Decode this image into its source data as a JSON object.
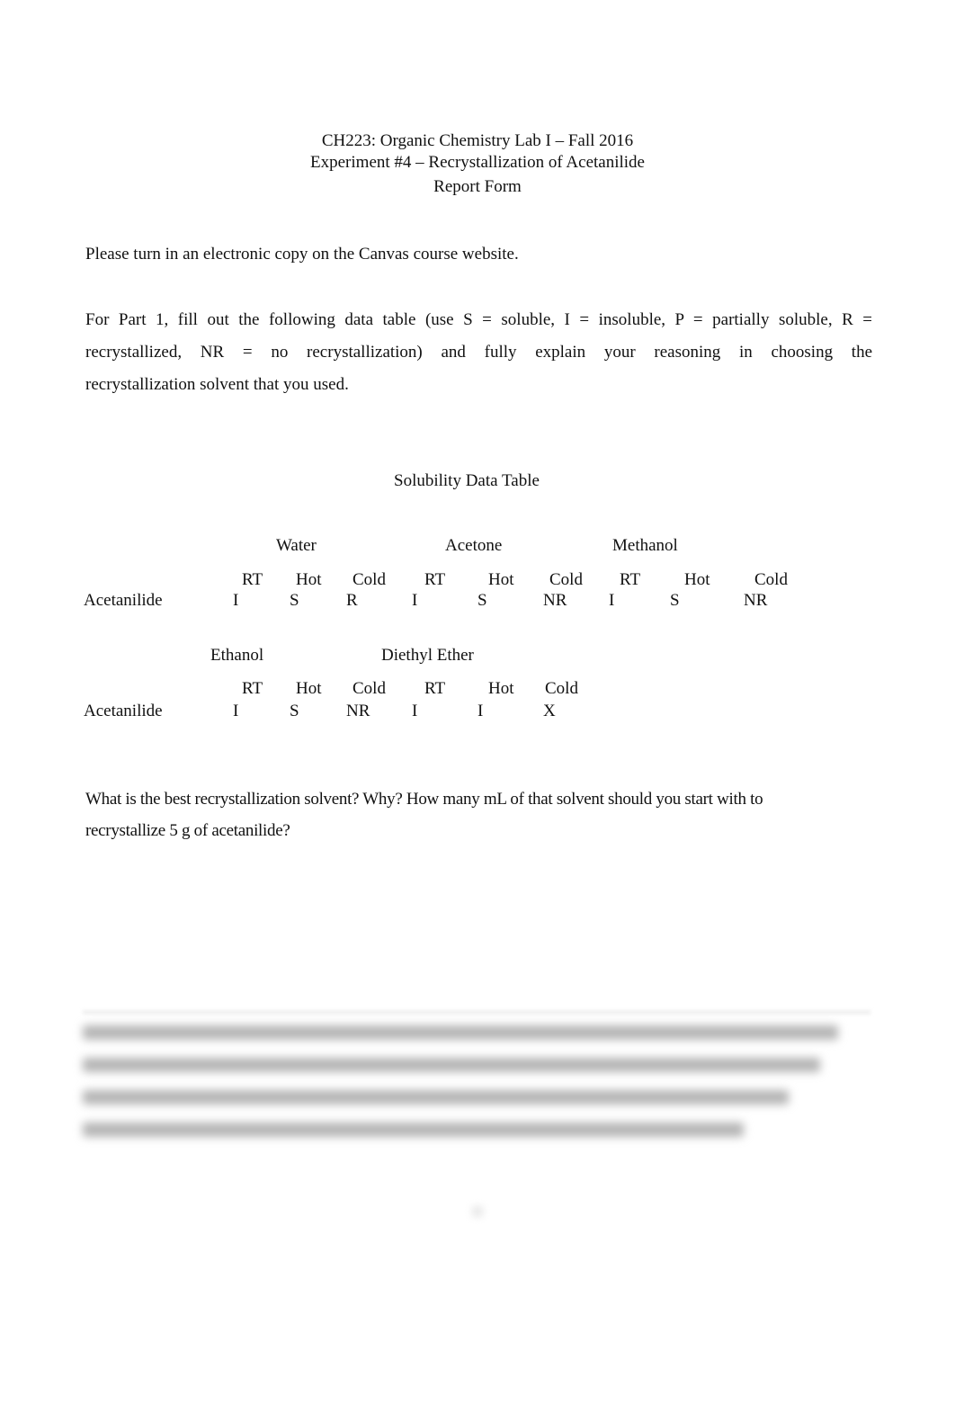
{
  "header": {
    "course": "CH223: Organic Chemistry Lab I – Fall 2016",
    "experiment": "Experiment #4 – Recrystallization of Acetanilide",
    "form": "Report Form"
  },
  "instructions": {
    "submission": "Please turn in an electronic copy on the Canvas course website.",
    "part1_lines": [
      "For Part 1, fill out the following data table (use S = soluble, I = insoluble, P = partially soluble, R =",
      "recrystallized, NR = no recrystallization) and fully explain your reasoning in choosing the",
      "recrystallization solvent that you used."
    ]
  },
  "table": {
    "title": "Solubility Data Table",
    "compound": "Acetanilide",
    "conditions": [
      "RT",
      "Hot",
      "Cold"
    ],
    "block1": {
      "solvents": [
        "Water",
        "Acetone",
        "Methanol"
      ],
      "values": [
        "I",
        "S",
        "R",
        "I",
        "S",
        "NR",
        "I",
        "S",
        "NR"
      ]
    },
    "block2": {
      "solvents": [
        "Ethanol",
        "Diethyl Ether"
      ],
      "values": [
        "I",
        "S",
        "NR",
        "I",
        "I",
        "X"
      ]
    }
  },
  "question": {
    "lines": [
      "What is the best recrystallization solvent?  Why?  How many mL of that solvent should you start with to",
      "recrystallize 5 g of acetanilide?"
    ]
  },
  "answer": {
    "blurred": true,
    "line_count": 4
  }
}
